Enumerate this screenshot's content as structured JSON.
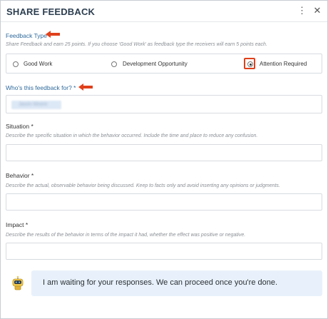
{
  "dialog": {
    "title": "SHARE FEEDBACK",
    "menu_glyph": "⋮",
    "close_glyph": "✕"
  },
  "feedback_type": {
    "label": "Feedback Type",
    "hint": "Share Feedback and earn 25 points. If you choose 'Good Work' as feedback type the receivers will earn 5 points each.",
    "options": [
      {
        "label": "Good Work",
        "checked": false
      },
      {
        "label": "Development Opportunity",
        "checked": false
      },
      {
        "label": "Attention Required",
        "checked": true
      }
    ]
  },
  "recipient": {
    "label": "Who's this feedback for? *",
    "selected_name": "Jason Moore"
  },
  "situation": {
    "label": "Situation *",
    "hint": "Describe the specific situation in which the behavior occurred. Include the time and place to reduce any confusion.",
    "value": ""
  },
  "behavior": {
    "label": "Behavior *",
    "hint": "Describe the actual, observable behavior being discussed. Keep to facts only and avoid inserting any opinions or judgments.",
    "value": ""
  },
  "impact": {
    "label": "Impact *",
    "hint": "Describe the results of the behavior in terms of the impact it had, whether the effect was positive or negative.",
    "value": ""
  },
  "assistant": {
    "icon": "robot-icon",
    "message": "I am waiting for your responses. We can proceed once you're done."
  },
  "colors": {
    "accent_blue": "#2f6a9c",
    "annotation_red": "#e0401b",
    "bubble_bg": "#e8f1fb"
  }
}
